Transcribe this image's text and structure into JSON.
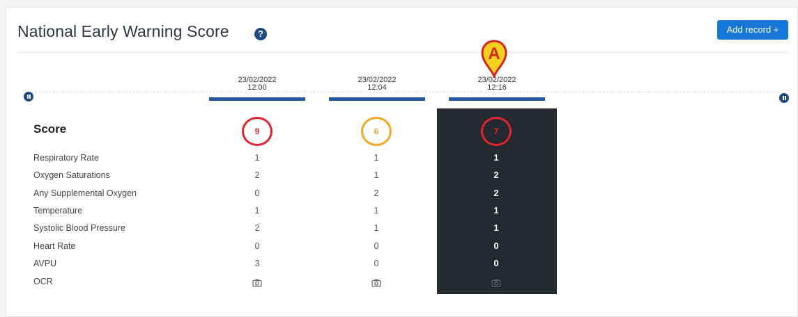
{
  "header": {
    "title": "National Early Warning Score",
    "help_icon": "?",
    "add_button": "Add record +"
  },
  "callout": {
    "letter": "A",
    "color": "#f6d21f",
    "border": "#d7241f"
  },
  "columns": [
    {
      "date": "23/02/2022",
      "time": "12:00",
      "score": "9",
      "score_color": "#e0252a",
      "selected": false
    },
    {
      "date": "23/02/2022",
      "time": "12:04",
      "score": "6",
      "score_color": "#f5a623",
      "selected": false
    },
    {
      "date": "23/02/2022",
      "time": "12:16",
      "score": "7",
      "score_color": "#e0252a",
      "selected": true
    }
  ],
  "score_label": "Score",
  "rows": [
    {
      "label": "Respiratory Rate",
      "values": [
        "1",
        "1",
        "1"
      ]
    },
    {
      "label": "Oxygen Saturations",
      "values": [
        "2",
        "1",
        "2"
      ]
    },
    {
      "label": "Any Supplemental Oxygen",
      "values": [
        "0",
        "2",
        "2"
      ]
    },
    {
      "label": "Temperature",
      "values": [
        "1",
        "1",
        "1"
      ]
    },
    {
      "label": "Systolic Blood Pressure",
      "values": [
        "2",
        "1",
        "1"
      ]
    },
    {
      "label": "Heart Rate",
      "values": [
        "0",
        "0",
        "0"
      ]
    },
    {
      "label": "AVPU",
      "values": [
        "3",
        "0",
        "0"
      ]
    }
  ],
  "ocr_label": "OCR",
  "ocr_icon": "camera-icon",
  "colors": {
    "accent": "#1677d6",
    "bar": "#2559a5",
    "selected_bg": "#262a30",
    "nav_icon": "#1f4a84"
  }
}
